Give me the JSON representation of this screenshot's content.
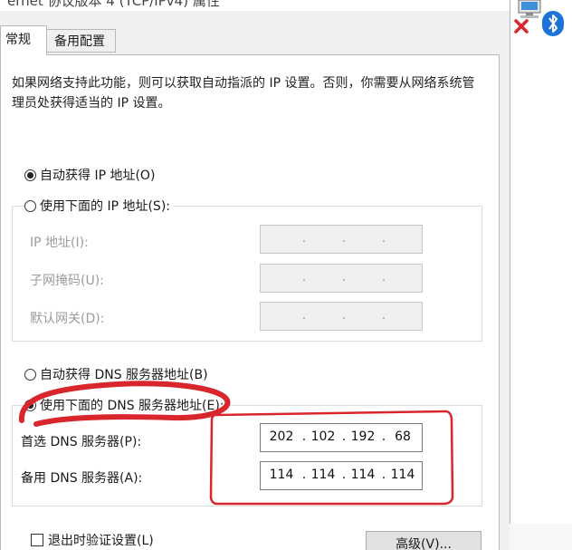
{
  "window": {
    "title": "ernet 协议版本 4 (TCP/IPv4) 属性",
    "close_glyph": "✕"
  },
  "tabs": [
    {
      "label": "常规"
    },
    {
      "label": "备用配置"
    }
  ],
  "description": "如果网络支持此功能，则可以获取自动指派的 IP 设置。否则，你需要从网络系统管理员处获得适当的 IP 设置。",
  "ip_mode": {
    "auto_label": "自动获得 IP 地址(O)",
    "manual_label": "使用下面的 IP 地址(S):",
    "selected": "auto"
  },
  "ip_fields": [
    {
      "label": "IP 地址(I):",
      "octets": [
        "",
        "",
        "",
        ""
      ]
    },
    {
      "label": "子网掩码(U):",
      "octets": [
        "",
        "",
        "",
        ""
      ]
    },
    {
      "label": "默认网关(D):",
      "octets": [
        "",
        "",
        "",
        ""
      ]
    }
  ],
  "dns_mode": {
    "auto_label": "自动获得 DNS 服务器地址(B)",
    "manual_label": "使用下面的 DNS 服务器地址(E):",
    "selected": "manual"
  },
  "dns_fields": [
    {
      "label": "首选 DNS 服务器(P):",
      "octets": [
        "202",
        "102",
        "192",
        "68"
      ]
    },
    {
      "label": "备用 DNS 服务器(A):",
      "octets": [
        "114",
        "114",
        "114",
        "114"
      ]
    }
  ],
  "validate_checkbox": {
    "label": "退出时验证设置(L)",
    "checked": false
  },
  "advanced_button": {
    "label": "高级(V)..."
  },
  "colors": {
    "annotation": "#d9262c",
    "bluetooth": "#1c74d6",
    "error_x": "#d9262c"
  },
  "icons": [
    "network-icon",
    "error-x-icon",
    "bluetooth-icon"
  ]
}
